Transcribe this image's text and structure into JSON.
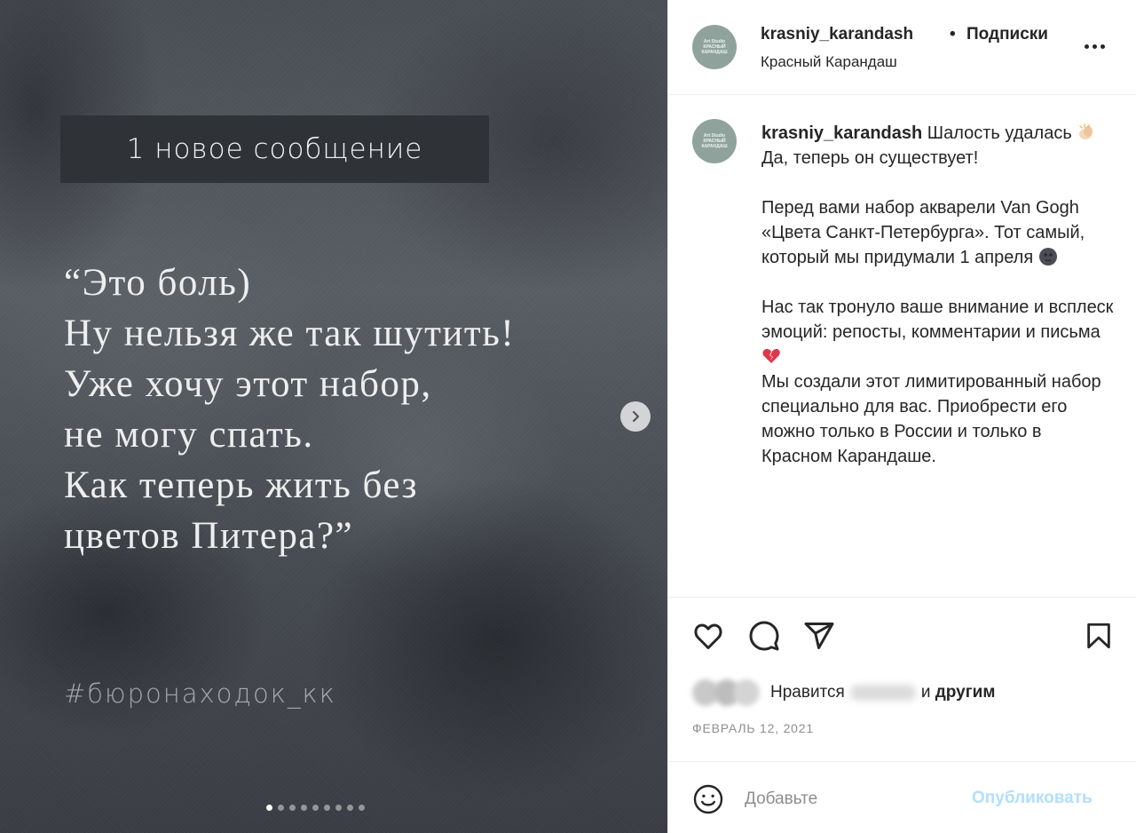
{
  "media": {
    "badge": "1 новое сообщение",
    "quote_lines": [
      "“Это боль)",
      "Ну нельзя же так шутить!",
      "Уже хочу этот набор,",
      "не могу спать.",
      "Как теперь жить без",
      "цветов Питера?”"
    ],
    "hashtag": "#бюронаходок_кк",
    "carousel_count": 9,
    "carousel_active": 1
  },
  "header": {
    "username": "krasniy_karandash",
    "separator": "•",
    "follow_label": "Подписки",
    "subtitle": "Красный Карандаш",
    "avatar_text": "Art Studio КРАСНЫЙ КАРАНДАШ"
  },
  "caption": {
    "username": "krasniy_karandash",
    "line1": "Шалость удалась",
    "line1b": "Да, теперь он существует!",
    "para2": "Перед вами набор акварели Van Gogh «Цвета Санкт-Петербурга». Тот самый, который мы придумали 1 апреля",
    "para3": "Нас так тронуло ваше внимание и всплеск эмоций: репосты, комментарии и письма",
    "para4": "Мы создали этот лимитированный набор специально для вас. Приобрести его можно только в России и только в Красном Карандаше."
  },
  "actions": {
    "icons": [
      "heart-icon",
      "comment-icon",
      "share-icon",
      "bookmark-icon"
    ],
    "likes_prefix": "Нравится",
    "likes_suffix": "и",
    "likes_others": "другим",
    "date": "ФЕВРАЛЬ 12, 2021"
  },
  "comment": {
    "placeholder": "Добавьте",
    "publish_label": "Опубликовать",
    "publish_color": "#b2dffc"
  }
}
